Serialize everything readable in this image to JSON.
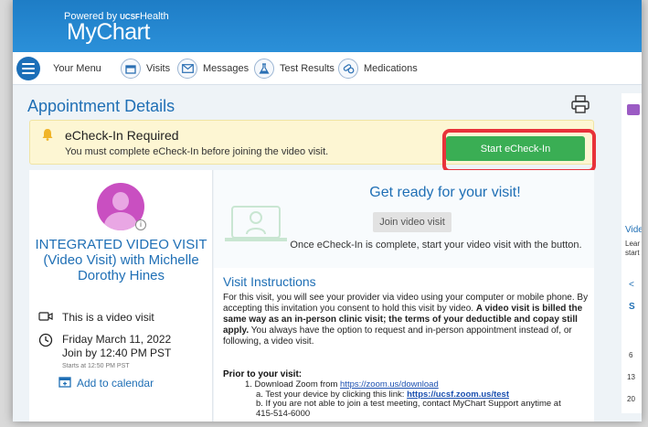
{
  "header": {
    "powered_by": "Powered by",
    "ucsf_brand": "UCSF",
    "health": "Health",
    "app_name": "MyChart"
  },
  "nav": {
    "menu_label": "Your Menu",
    "items": [
      {
        "label": "Visits",
        "icon": "calendar-icon"
      },
      {
        "label": "Messages",
        "icon": "envelope-icon"
      },
      {
        "label": "Test Results",
        "icon": "flask-icon"
      },
      {
        "label": "Medications",
        "icon": "pills-icon"
      }
    ]
  },
  "page": {
    "title": "Appointment Details"
  },
  "echeckin": {
    "title": "eCheck-In Required",
    "message": "You must complete eCheck-In before joining the video visit.",
    "button_label": "Start eCheck-In"
  },
  "appointment": {
    "provider_title": "INTEGRATED VIDEO VISIT (Video Visit) with Michelle Dorothy Hines",
    "video_note": "This is a video visit",
    "date": "Friday March 11, 2022",
    "join_by": "Join by 12:40 PM PST",
    "starts_at": "Starts at 12:50 PM PST",
    "add_calendar": "Add to calendar"
  },
  "visit": {
    "ready_title": "Get ready for your visit!",
    "join_button": "Join video visit",
    "ready_message": "Once eCheck-In is complete, start your video visit with the button.",
    "instructions_title": "Visit Instructions",
    "instructions_text_1": "For this visit, you will see your provider via video using your computer or mobile phone.  By accepting this invitation you consent to hold this visit by video.  ",
    "instructions_bold": "A video visit is billed the same way as an in-person clinic visit; the terms of your deductible and copay still apply.",
    "instructions_text_2": "  You always have the option to request and in-person appointment instead of, or following, a video visit.",
    "prior_title": "Prior to your visit:",
    "step1_prefix": "1. Download Zoom from ",
    "step1_link": "https://zoom.us/download",
    "step1a_prefix": "a. Test your device by clicking this link: ",
    "step1a_link": "https://ucsf.zoom.us/test",
    "step1b_line1": "b. If you are not able to join a test meeting, contact MyChart Support anytime at",
    "step1b_line2": "415-514-6000"
  },
  "side": {
    "label_1": "Vide",
    "label_2": "Lear",
    "label_3": "start",
    "cal_header": "S",
    "cal_nav": "<",
    "dates": [
      "6",
      "13",
      "20"
    ]
  },
  "colors": {
    "brand_blue": "#1f6fb5",
    "header_blue": "#2b90d9",
    "checkin_green": "#3aae54",
    "highlight_red": "#e8323a",
    "banner_yellow": "#fdf6d3"
  }
}
